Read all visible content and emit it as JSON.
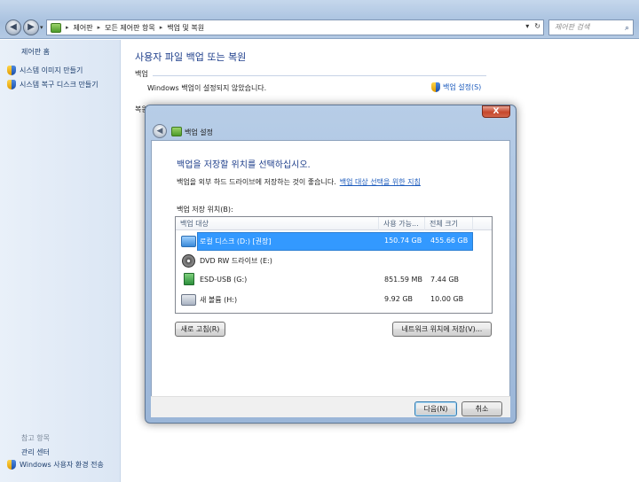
{
  "window": {
    "breadcrumbs": [
      "제어판",
      "모든 제어판 항목",
      "백업 및 복원"
    ],
    "search_placeholder": "제어판 검색"
  },
  "sidebar": {
    "home": "제어판 홈",
    "tasks": [
      "시스템 이미지 만들기",
      "시스템 복구 디스크 만들기"
    ],
    "see_also_title": "참고 항목",
    "see_also": [
      "관리 센터",
      "Windows 사용자 환경 전송"
    ]
  },
  "main": {
    "title": "사용자 파일 백업 또는 복원",
    "backup_section": "백업",
    "backup_status": "Windows 백업이 설정되지 않았습니다.",
    "setup_link": "백업 설정(S)",
    "restore_section_partial": "복원"
  },
  "dialog": {
    "title": "백업 설정",
    "close_symbol": "X",
    "heading": "백업을 저장할 위치를 선택하십시오.",
    "description": "백업을 외부 하드 드라이브에 저장하는 것이 좋습니다.",
    "guide_link": "백업 대상 선택을 위한 지침",
    "list_label": "백업 저장 위치(B):",
    "columns": [
      "백업 대상",
      "사용 가능...",
      "전체 크기"
    ],
    "drives": [
      {
        "name": "로컬 디스크 (D:) [권장]",
        "free": "150.74 GB",
        "total": "455.66 GB",
        "icon": "hard-drive-icon",
        "selected": true
      },
      {
        "name": "DVD RW 드라이브 (E:)",
        "free": "",
        "total": "",
        "icon": "dvd-drive-icon",
        "selected": false
      },
      {
        "name": "ESD-USB (G:)",
        "free": "851.59 MB",
        "total": "7.44 GB",
        "icon": "usb-drive-icon",
        "selected": false
      },
      {
        "name": "새 볼륨 (H:)",
        "free": "9.92 GB",
        "total": "10.00 GB",
        "icon": "hard-drive-icon",
        "selected": false
      }
    ],
    "refresh_button": "새로 고침(R)",
    "network_button": "네트워크 위치에 저장(V)...",
    "next_button": "다음(N)",
    "cancel_button": "취소"
  }
}
